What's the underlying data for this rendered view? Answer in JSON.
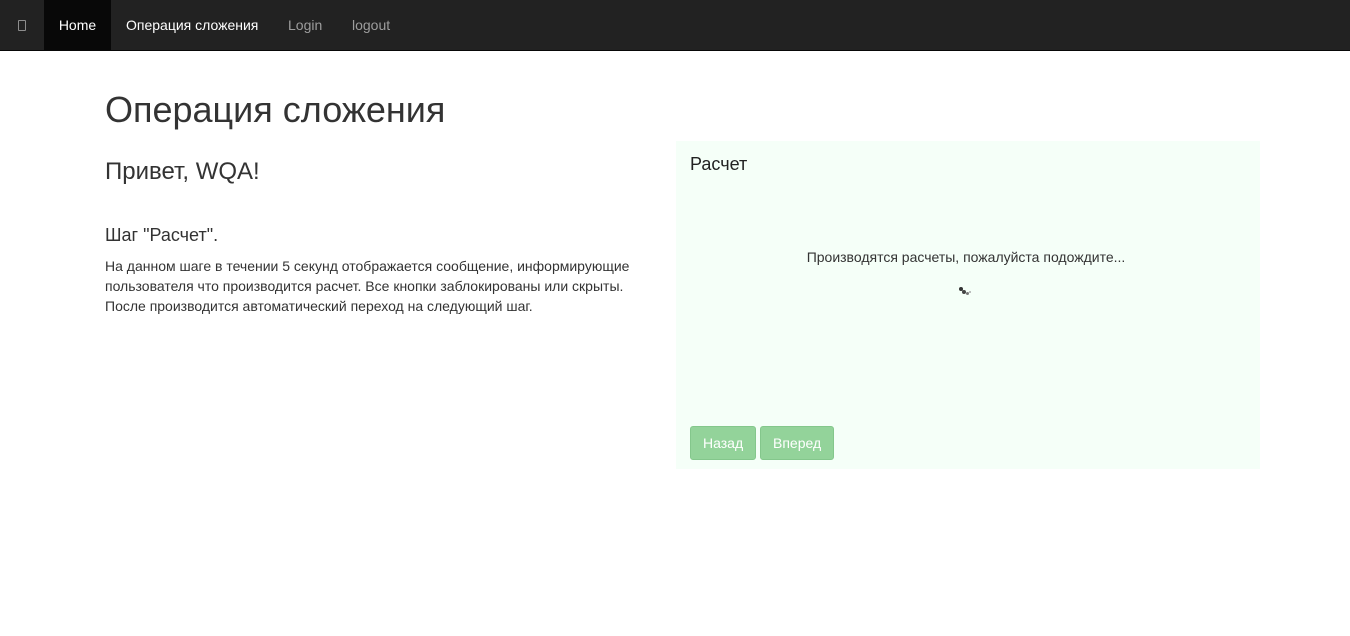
{
  "navbar": {
    "brand_icon": "unknown-glyph-icon",
    "items": [
      {
        "label": "Home",
        "active": true
      },
      {
        "label": "Операция сложения",
        "active": false
      },
      {
        "label": "Login",
        "active": false
      },
      {
        "label": "logout",
        "active": false
      }
    ]
  },
  "main": {
    "title": "Операция сложения",
    "greeting": "Привет, WQA!",
    "step_title": "Шаг \"Расчет\".",
    "step_description": "На данном шаге в течении 5 секунд отображается сообщение, информирующие пользователя что производится расчет. Все кнопки заблокированы или скрыты. После производится автоматический переход на следующий шаг."
  },
  "panel": {
    "title": "Расчет",
    "loading_text": "Производятся расчеты, пожалуйста подождите...",
    "spinner_icon": "loading-spinner-icon",
    "buttons": {
      "back_label": "Назад",
      "next_label": "Вперед",
      "disabled": true
    }
  },
  "colors": {
    "navbar_bg": "#222222",
    "panel_bg": "#f5fff8",
    "button_bg": "#93d39a"
  }
}
